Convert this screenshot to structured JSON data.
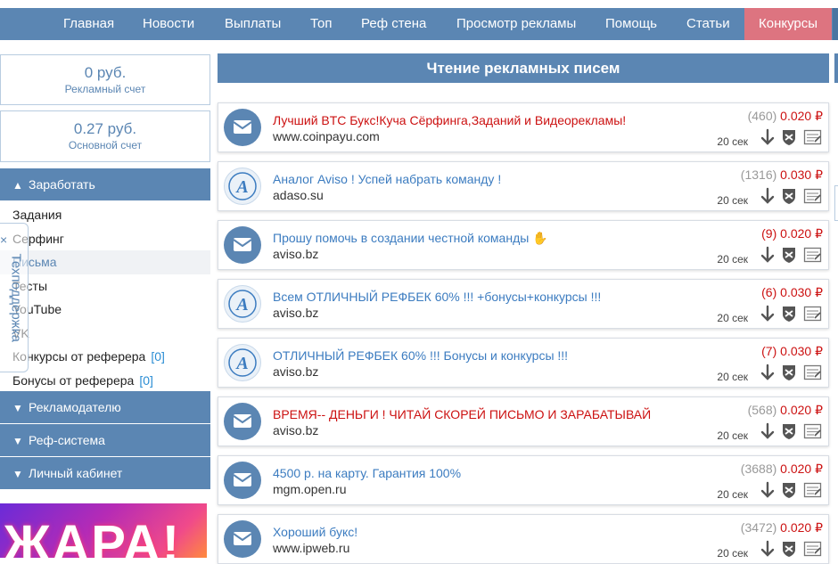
{
  "nav": {
    "items": [
      {
        "label": "Главная"
      },
      {
        "label": "Новости"
      },
      {
        "label": "Выплаты"
      },
      {
        "label": "Топ"
      },
      {
        "label": "Реф стена"
      },
      {
        "label": "Просмотр рекламы"
      },
      {
        "label": "Помощь"
      },
      {
        "label": "Статьи"
      },
      {
        "label": "Конкурсы"
      }
    ]
  },
  "balances": {
    "ad": {
      "amount": "0 руб.",
      "label": "Рекламный счет"
    },
    "main": {
      "amount": "0.27 руб.",
      "label": "Основной счет"
    }
  },
  "sidebar": {
    "earn": {
      "label": "Заработать"
    },
    "menu": [
      {
        "label": "Задания"
      },
      {
        "label": "Серфинг"
      },
      {
        "label": "Письма"
      },
      {
        "label": "Тесты"
      },
      {
        "label": "YouTube"
      },
      {
        "label": "VK"
      },
      {
        "label": "Конкурсы от реферера",
        "count": "[0]"
      },
      {
        "label": "Бонусы от реферера",
        "count": "[0]"
      }
    ],
    "advertiser": {
      "label": "Рекламодателю"
    },
    "refsystem": {
      "label": "Реф-система"
    },
    "cabinet": {
      "label": "Личный кабинет"
    }
  },
  "support": {
    "close": "×",
    "label": "Техподдержка"
  },
  "banner": {
    "text": "ЖАРА!"
  },
  "content": {
    "title": "Чтение рекламных писем",
    "time_label": "20 сек",
    "letters": [
      {
        "title": "Лучший BTC Букс!Куча Сёрфинга,Заданий и Видеорекламы!",
        "site": "www.coinpayu.com",
        "count": "(460)",
        "price": "0.020 ₽",
        "icon": "mail",
        "title_color": "red",
        "count_color": "gray"
      },
      {
        "title": "Аналог Aviso ! Успей набрать команду !",
        "site": "adaso.su",
        "count": "(1316)",
        "price": "0.030 ₽",
        "icon": "adv",
        "title_color": "blue",
        "count_color": "gray"
      },
      {
        "title": "Прошу помочь в создании честной команды ✋",
        "site": "aviso.bz",
        "count": "(9)",
        "price": "0.020 ₽",
        "icon": "mail",
        "title_color": "blue",
        "count_color": "red"
      },
      {
        "title": "Всем ОТЛИЧНЫЙ РЕФБЕК 60% !!! +бонусы+конкурсы !!!",
        "site": "aviso.bz",
        "count": "(6)",
        "price": "0.030 ₽",
        "icon": "adv",
        "title_color": "blue",
        "count_color": "red"
      },
      {
        "title": "ОТЛИЧНЫЙ РЕФБЕК 60% !!! Бонусы и конкурсы !!!",
        "site": "aviso.bz",
        "count": "(7)",
        "price": "0.030 ₽",
        "icon": "adv",
        "title_color": "blue",
        "count_color": "red"
      },
      {
        "title": "ВРЕМЯ-- ДЕНЬГИ ! ЧИТАЙ СКОРЕЙ ПИСЬМО И ЗАРАБАТЫВАЙ",
        "site": "aviso.bz",
        "count": "(568)",
        "price": "0.020 ₽",
        "icon": "mail",
        "title_color": "red",
        "count_color": "gray"
      },
      {
        "title": "4500 р. на карту. Гарантия 100%",
        "site": "mgm.open.ru",
        "count": "(3688)",
        "price": "0.020 ₽",
        "icon": "mail",
        "title_color": "blue",
        "count_color": "gray"
      },
      {
        "title": "Хороший букс!",
        "site": "www.ipweb.ru",
        "count": "(3472)",
        "price": "0.020 ₽",
        "icon": "mail",
        "title_color": "blue",
        "count_color": "gray"
      }
    ]
  },
  "colors": {
    "accent": "#5b86b3",
    "active_tab": "#dd7480",
    "price_red": "#cc1111",
    "link_blue": "#3c7cc0"
  }
}
